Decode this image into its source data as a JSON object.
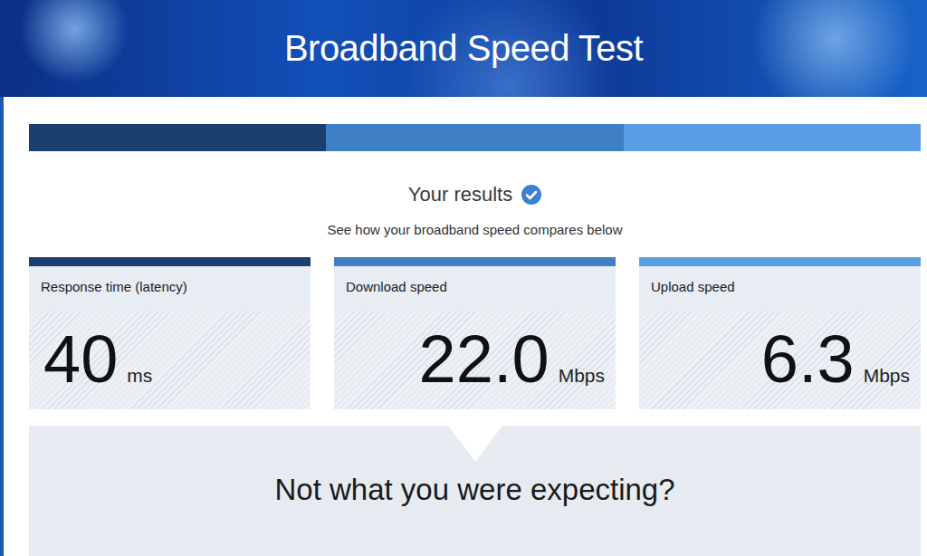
{
  "header": {
    "title": "Broadband Speed Test"
  },
  "progress": {
    "level": 1
  },
  "summary": {
    "title": "Your results",
    "subtitle": "See how your broadband speed compares below"
  },
  "results": [
    {
      "label": "Response time (latency)",
      "value": "40",
      "unit": "ms",
      "color": "#1b3f6e"
    },
    {
      "label": "Download speed",
      "value": "22.0",
      "unit": "Mbps",
      "color": "#3e7fc6"
    },
    {
      "label": "Upload speed",
      "value": "6.3",
      "unit": "Mbps",
      "color": "#5a9de4"
    }
  ],
  "callout": {
    "text": "Not what you were expecting?"
  }
}
